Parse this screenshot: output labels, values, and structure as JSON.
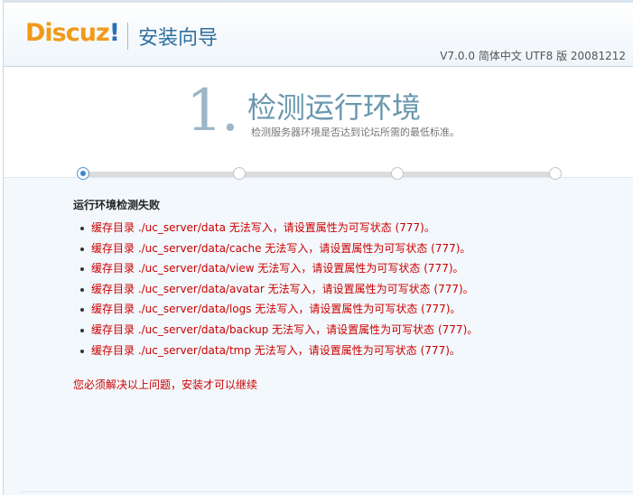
{
  "header": {
    "logo_main": "Discuz",
    "logo_bang": "!",
    "app_title": "安装向导",
    "version": "V7.0.0 简体中文 UTF8 版 20081212"
  },
  "step": {
    "number": "1.",
    "title": "检测运行环境",
    "description": "检测服务器环境是否达到论坛所需的最低标准。",
    "total_steps": 4,
    "current_step": 1
  },
  "result": {
    "title": "运行环境检测失败",
    "errors": [
      "缓存目录 ./uc_server/data 无法写入，请设置属性为可写状态 (777)。",
      "缓存目录 ./uc_server/data/cache 无法写入，请设置属性为可写状态 (777)。",
      "缓存目录 ./uc_server/data/view 无法写入，请设置属性为可写状态 (777)。",
      "缓存目录 ./uc_server/data/avatar 无法写入，请设置属性为可写状态 (777)。",
      "缓存目录 ./uc_server/data/logs 无法写入，请设置属性为可写状态 (777)。",
      "缓存目录 ./uc_server/data/backup 无法写入，请设置属性为可写状态 (777)。",
      "缓存目录 ./uc_server/data/tmp 无法写入，请设置属性为可写状态 (777)。"
    ],
    "final_note": "您必须解决以上问题，安装才可以继续"
  },
  "colors": {
    "logo_orange": "#f09a1a",
    "logo_blue": "#2a6fb3",
    "error_red": "#cc0000",
    "active_step_blue": "#3d87cc"
  }
}
